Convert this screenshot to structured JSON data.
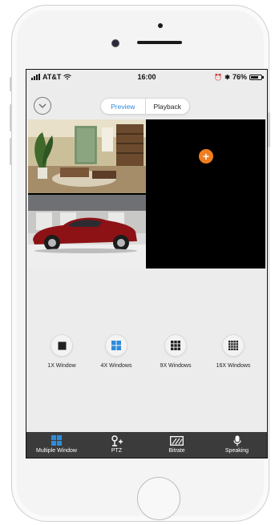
{
  "statusbar": {
    "carrier": "AT&T",
    "time": "16:00",
    "battery_text": "76%",
    "battery_level": 0.76
  },
  "topbar": {
    "tabs": [
      {
        "label": "Preview",
        "active": true
      },
      {
        "label": "Playback",
        "active": false
      }
    ]
  },
  "grid": {
    "add_symbol": "+"
  },
  "modes": [
    {
      "label": "1X Window",
      "icon": "single-window-icon",
      "selected": false
    },
    {
      "label": "4X Windows",
      "icon": "four-window-icon",
      "selected": true
    },
    {
      "label": "9X Windows",
      "icon": "nine-window-icon",
      "selected": false
    },
    {
      "label": "16X Windows",
      "icon": "sixteen-window-icon",
      "selected": false
    }
  ],
  "tabbar": {
    "items": [
      {
        "label": "Multiple Window",
        "icon": "multiple-window-icon"
      },
      {
        "label": "PTZ",
        "icon": "ptz-icon"
      },
      {
        "label": "Bitrate",
        "icon": "bitrate-icon"
      },
      {
        "label": "Speaking",
        "icon": "microphone-icon"
      }
    ]
  },
  "colors": {
    "accent_blue": "#2f8bd8",
    "add_orange": "#f07d1f",
    "tabbar_bg": "#3b3b3b"
  }
}
